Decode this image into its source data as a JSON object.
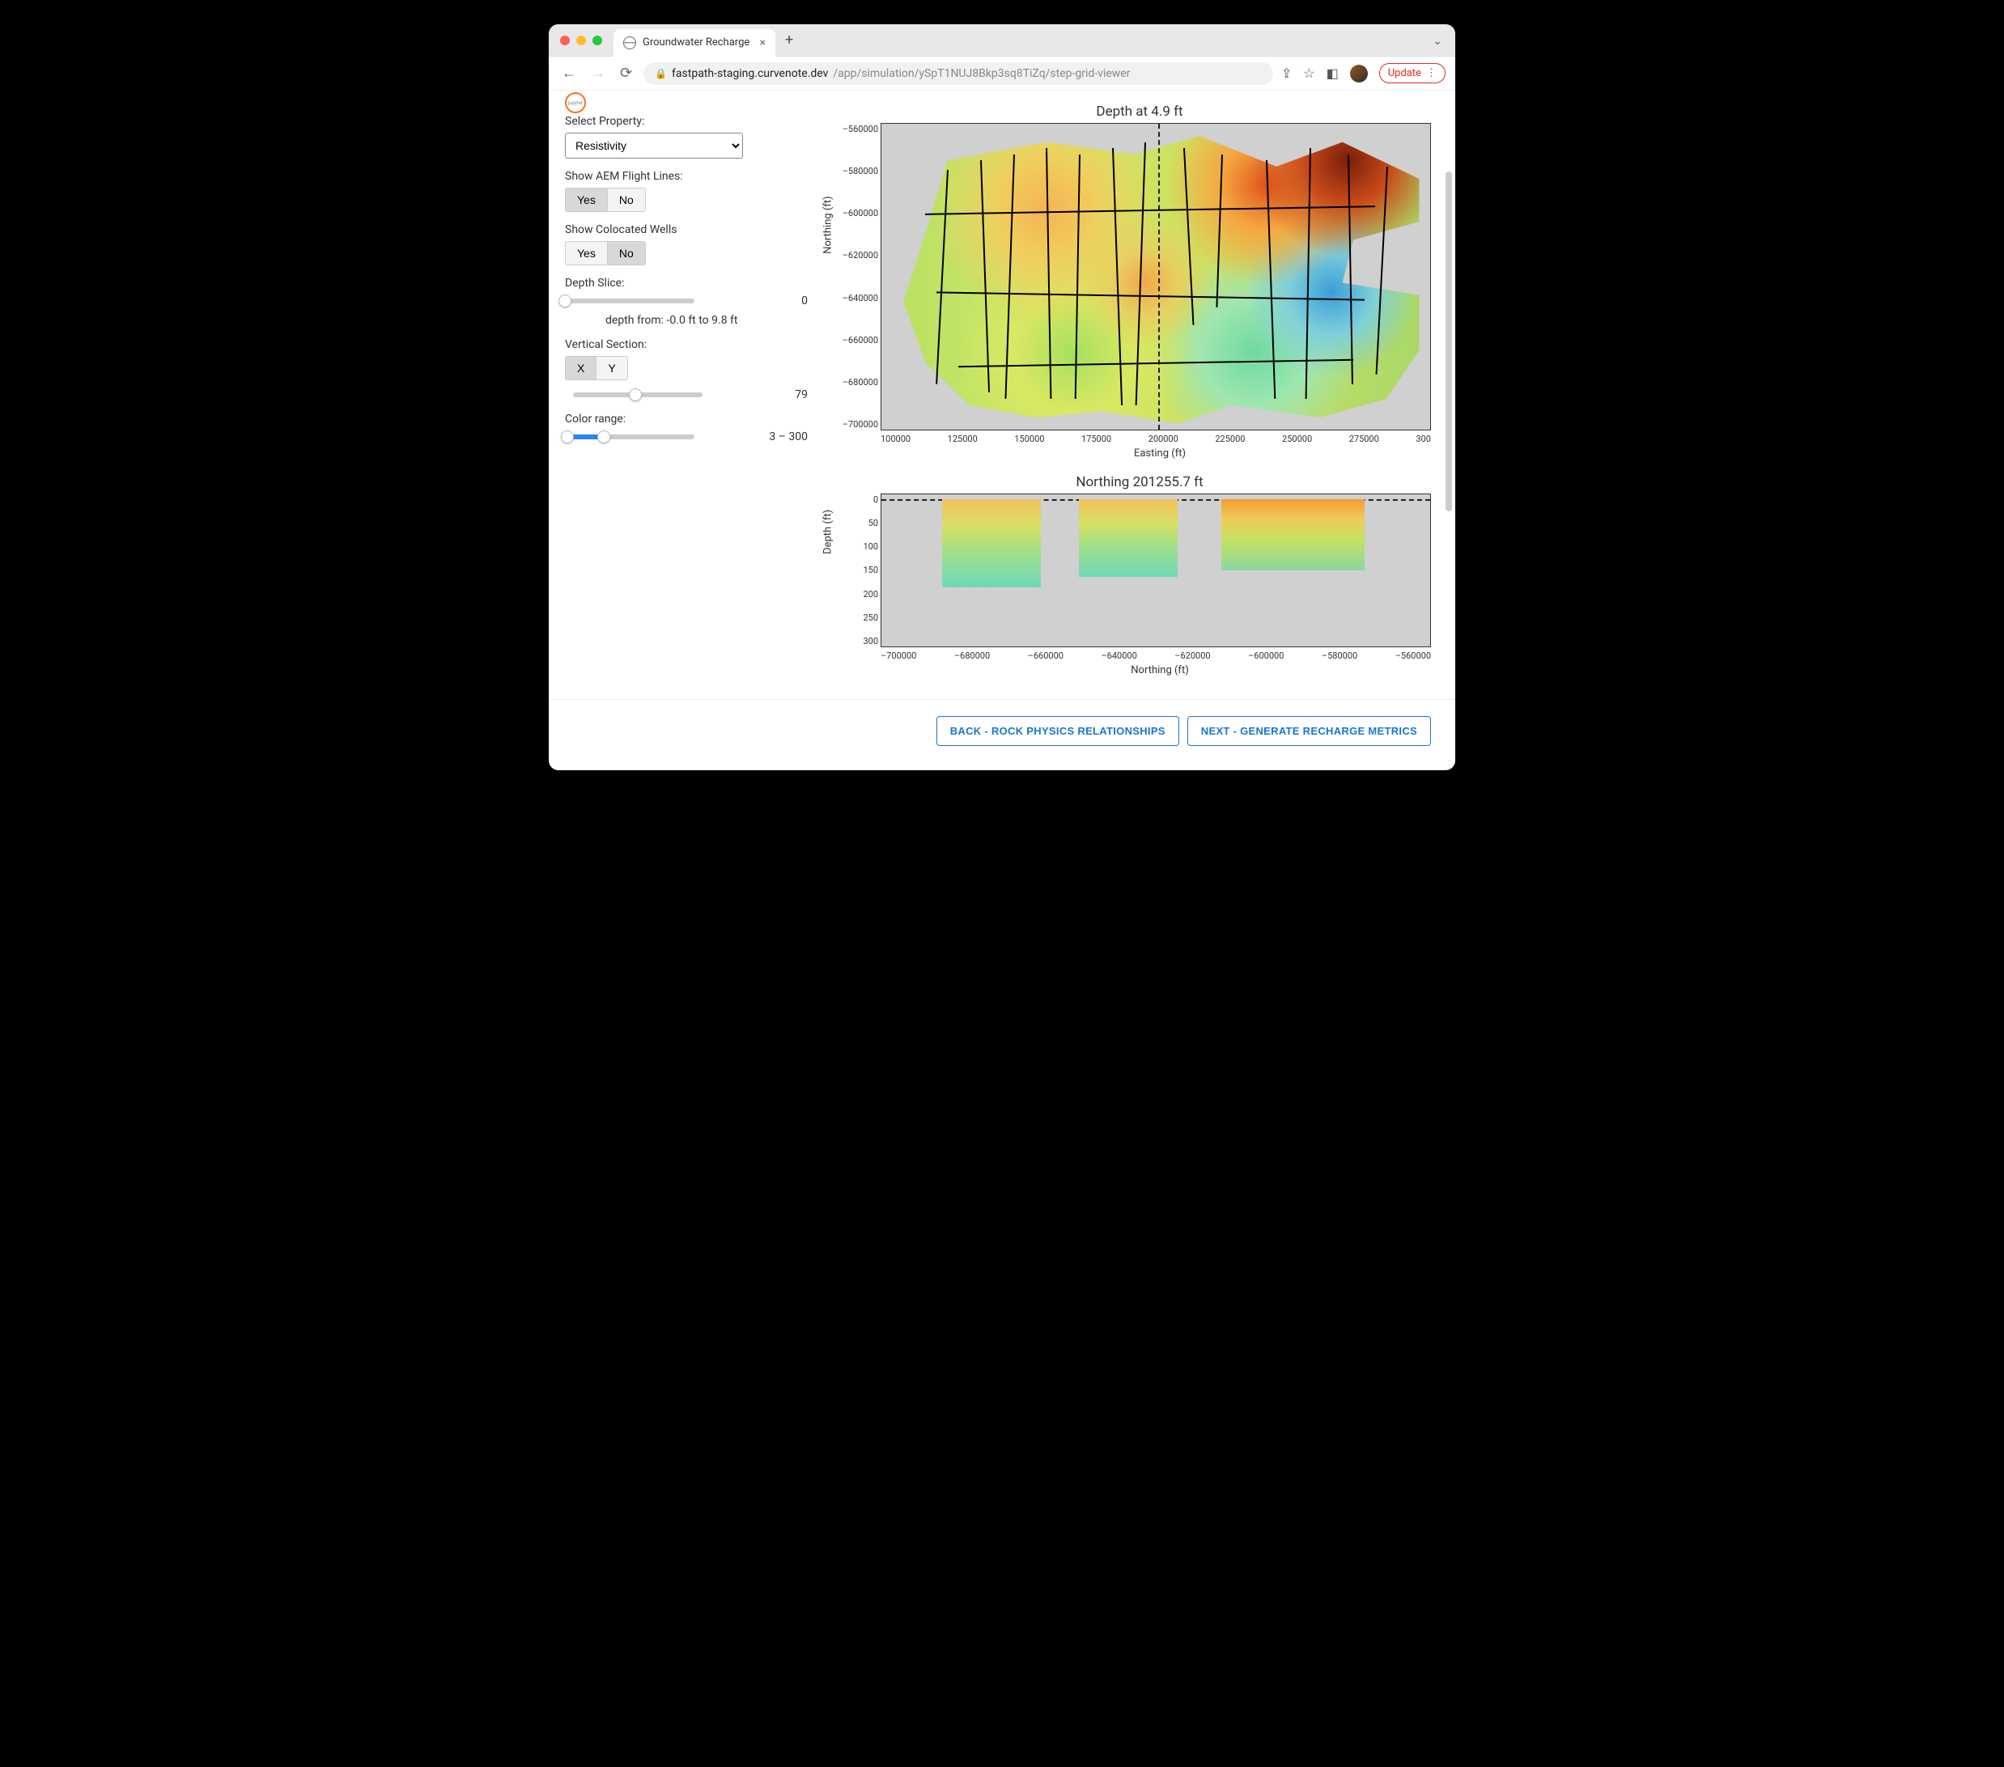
{
  "browser": {
    "tab_title": "Groundwater Recharge",
    "url_domain": "fastpath-staging.curvenote.dev",
    "url_path": "/app/simulation/ySpT1NUJ8Bkp3sq8TiZq/step-grid-viewer",
    "update_label": "Update"
  },
  "sidebar": {
    "select_property_label": "Select Property:",
    "select_property_value": "Resistivity",
    "aem_label": "Show AEM Flight Lines:",
    "aem_yes": "Yes",
    "aem_no": "No",
    "colocated_label": "Show Colocated Wells",
    "colocated_yes": "Yes",
    "colocated_no": "No",
    "depth_slice_label": "Depth Slice:",
    "depth_slice_value": "0",
    "depth_range_note": "depth from: -0.0 ft to 9.8 ft",
    "vertical_section_label": "Vertical Section:",
    "vs_x": "X",
    "vs_y": "Y",
    "vs_value": "79",
    "color_range_label": "Color range:",
    "color_range_value": "3 – 300"
  },
  "chart_top": {
    "title": "Depth at 4.9 ft",
    "xlabel": "Easting (ft)",
    "ylabel": "Northing (ft)",
    "yticks": [
      "–560000",
      "–580000",
      "–600000",
      "–620000",
      "–640000",
      "–660000",
      "–680000",
      "–700000"
    ],
    "xticks": [
      "100000",
      "125000",
      "150000",
      "175000",
      "200000",
      "225000",
      "250000",
      "275000",
      "300"
    ]
  },
  "chart_bottom": {
    "title": "Northing 201255.7 ft",
    "xlabel": "Northing (ft)",
    "ylabel": "Depth (ft)",
    "yticks": [
      "0",
      "50",
      "100",
      "150",
      "200",
      "250",
      "300"
    ],
    "xticks": [
      "–700000",
      "–680000",
      "–660000",
      "–640000",
      "–620000",
      "–600000",
      "–580000",
      "–560000"
    ]
  },
  "footer": {
    "back_label": "BACK - ROCK PHYSICS RELATIONSHIPS",
    "next_label": "NEXT - GENERATE RECHARGE METRICS"
  },
  "chart_data": [
    {
      "type": "heatmap",
      "title": "Depth at 4.9 ft",
      "xlabel": "Easting (ft)",
      "ylabel": "Northing (ft)",
      "xlim": [
        100000,
        300000
      ],
      "ylim": [
        -710000,
        -550000
      ],
      "colorbar_range": [
        3,
        300
      ],
      "colorbar_variable": "Resistivity",
      "overlays": [
        "AEM flight lines",
        "vertical section marker at Easting ≈ 201256 ft"
      ],
      "description": "Plan-view resistivity heatmap at depth slice 4.9 ft. Warm colors (orange/red) concentrate in the NE quadrant near Easting 250000–290000 / Northing -560000 to -600000. Cool greens dominate the west and south. A localized cool (blue) anomaly appears near Easting 260000 / Northing -645000. Black dashed/dotted overlays indicate AEM flight lines across the survey footprint."
    },
    {
      "type": "heatmap",
      "title": "Northing 201255.7 ft",
      "xlabel": "Northing (ft)",
      "ylabel": "Depth (ft)",
      "xlim": [
        -700000,
        -550000
      ],
      "ylim": [
        300,
        0
      ],
      "colorbar_range": [
        3,
        300
      ],
      "colorbar_variable": "Resistivity",
      "overlays": [
        "horizontal dashed line at depth ≈ 5 ft"
      ],
      "sections": [
        {
          "northing_range": [
            -685000,
            -655000
          ],
          "depth_range": [
            0,
            185
          ],
          "resistivity_trend": "moderate→low (yellow to teal with depth)"
        },
        {
          "northing_range": [
            -650000,
            -620000
          ],
          "depth_range": [
            0,
            160
          ],
          "resistivity_trend": "moderate→low (yellow-green to green with depth)"
        },
        {
          "northing_range": [
            -610000,
            -565000
          ],
          "depth_range": [
            0,
            150
          ],
          "resistivity_trend": "high near surface (orange) grading to green with depth"
        }
      ],
      "description": "Vertical cross-section along X at index 79 showing resistivity vs depth for three disjoint data columns."
    }
  ]
}
